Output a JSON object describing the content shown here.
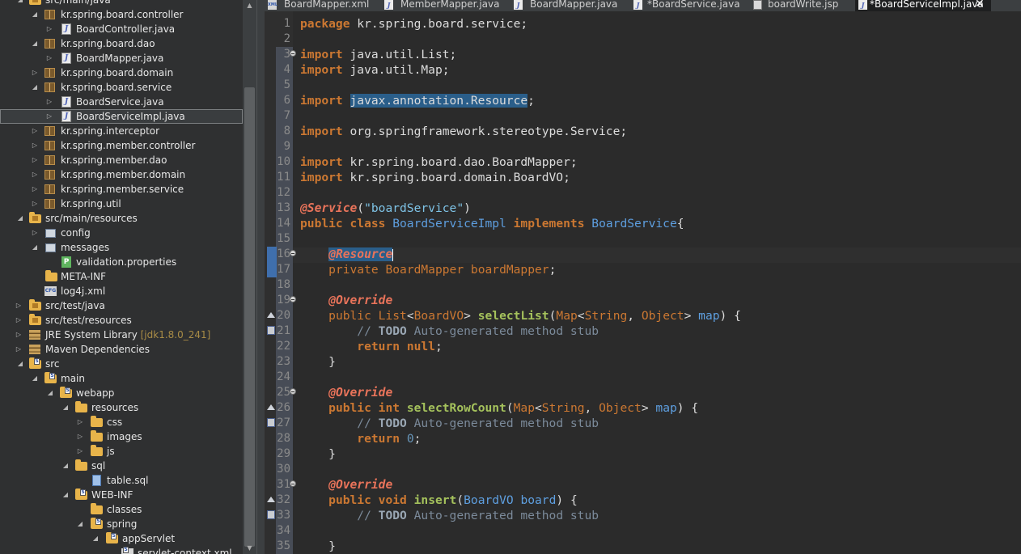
{
  "explorer": {
    "items": [
      {
        "label": "src/main/java",
        "icon": "source-folder-icon"
      },
      {
        "label": "kr.spring.board.controller",
        "icon": "package-icon"
      },
      {
        "label": "BoardController.java",
        "icon": "java-file-icon"
      },
      {
        "label": "kr.spring.board.dao",
        "icon": "package-icon"
      },
      {
        "label": "BoardMapper.java",
        "icon": "java-file-icon"
      },
      {
        "label": "kr.spring.board.domain",
        "icon": "package-icon"
      },
      {
        "label": "kr.spring.board.service",
        "icon": "package-icon"
      },
      {
        "label": "BoardService.java",
        "icon": "java-file-icon"
      },
      {
        "label": "BoardServiceImpl.java",
        "icon": "java-file-icon"
      },
      {
        "label": "kr.spring.interceptor",
        "icon": "package-icon"
      },
      {
        "label": "kr.spring.member.controller",
        "icon": "package-icon"
      },
      {
        "label": "kr.spring.member.dao",
        "icon": "package-icon"
      },
      {
        "label": "kr.spring.member.domain",
        "icon": "package-icon"
      },
      {
        "label": "kr.spring.member.service",
        "icon": "package-icon"
      },
      {
        "label": "kr.spring.util",
        "icon": "package-icon"
      },
      {
        "label": "src/main/resources",
        "icon": "source-folder-icon"
      },
      {
        "label": "config",
        "icon": "config-icon"
      },
      {
        "label": "messages",
        "icon": "config-icon"
      },
      {
        "label": "validation.properties",
        "icon": "properties-file-icon"
      },
      {
        "label": "META-INF",
        "icon": "folder-icon"
      },
      {
        "label": "log4j.xml",
        "icon": "xml-file-icon"
      },
      {
        "label": "src/test/java",
        "icon": "source-folder-icon"
      },
      {
        "label": "src/test/resources",
        "icon": "source-folder-icon"
      },
      {
        "label": "JRE System Library",
        "decoration": "[jdk1.8.0_241]",
        "icon": "library-icon"
      },
      {
        "label": "Maven Dependencies",
        "icon": "library-icon"
      },
      {
        "label": "src",
        "icon": "folder-icon"
      },
      {
        "label": "main",
        "icon": "folder-icon"
      },
      {
        "label": "webapp",
        "icon": "folder-icon"
      },
      {
        "label": "resources",
        "icon": "folder-icon"
      },
      {
        "label": "css",
        "icon": "folder-icon"
      },
      {
        "label": "images",
        "icon": "folder-icon"
      },
      {
        "label": "js",
        "icon": "folder-icon"
      },
      {
        "label": "sql",
        "icon": "folder-icon"
      },
      {
        "label": "table.sql",
        "icon": "sql-file-icon"
      },
      {
        "label": "WEB-INF",
        "icon": "folder-icon"
      },
      {
        "label": "classes",
        "icon": "folder-icon"
      },
      {
        "label": "spring",
        "icon": "folder-icon"
      },
      {
        "label": "appServlet",
        "icon": "folder-icon"
      },
      {
        "label": "servlet-context.xml",
        "icon": "xml-file-icon"
      }
    ]
  },
  "tabs": [
    {
      "label": "BoardMapper.xml",
      "icon": "xml-file-icon"
    },
    {
      "label": "MemberMapper.java",
      "icon": "java-file-icon"
    },
    {
      "label": "BoardMapper.java",
      "icon": "java-file-icon"
    },
    {
      "label": "*BoardService.java",
      "icon": "java-file-icon"
    },
    {
      "label": "boardWrite.jsp",
      "icon": "jsp-file-icon"
    },
    {
      "label": "*BoardServiceImpl.java",
      "icon": "java-file-icon",
      "active": true,
      "close": "✕"
    }
  ],
  "editor": {
    "line_numbers": [
      "1",
      "2",
      "3",
      "4",
      "5",
      "6",
      "7",
      "8",
      "9",
      "10",
      "11",
      "12",
      "13",
      "14",
      "15",
      "16",
      "17",
      "18",
      "19",
      "20",
      "21",
      "22",
      "23",
      "24",
      "25",
      "26",
      "27",
      "28",
      "29",
      "30",
      "31",
      "32",
      "33",
      "34",
      "35"
    ],
    "code": {
      "l1_kw": "package",
      "l1_rest": " kr.spring.board.service;",
      "l3_kw": "import",
      "l3_rest": " java.util.List;",
      "l4_kw": "import",
      "l4_rest": " java.util.Map;",
      "l6_kw": "import",
      "l6_hl": "javax.annotation.Resource",
      "l6_end": ";",
      "l8_kw": "import",
      "l8_rest": " org.springframework.stereotype.Service;",
      "l10_kw": "import",
      "l10_rest": " kr.spring.board.dao.BoardMapper;",
      "l11_kw": "import",
      "l11_rest": " kr.spring.board.domain.BoardVO;",
      "l13_an": "@Service",
      "l13_p1": "(",
      "l13_str": "\"boardService\"",
      "l13_p2": ")",
      "l14_kw1": "public class",
      "l14_cls": "BoardServiceImpl",
      "l14_kw2": "implements",
      "l14_iface": "BoardService",
      "l14_brace": "{",
      "l16_an": "@Resource",
      "l17_kw": "private",
      "l17_type": "BoardMapper",
      "l17_var": "boardMapper",
      "l17_end": ";",
      "l19_an": "@Override",
      "l20_kw": "public",
      "l20_type": "List",
      "l20_lt": "<",
      "l20_gen": "BoardVO",
      "l20_gt": ">",
      "l20_fn": "selectList",
      "l20_p1": "(",
      "l20_map": "Map",
      "l20_lt2": "<",
      "l20_str": "String",
      "l20_comma": ", ",
      "l20_obj": "Object",
      "l20_gt2": ">",
      "l20_arg": "map",
      "l20_end": ") {",
      "l21_c1": "// ",
      "l21_todo": "TODO",
      "l21_c2": " Auto-generated method stub",
      "l22_kw": "return",
      "l22_val": "null",
      "l22_end": ";",
      "l23": "}",
      "l25_an": "@Override",
      "l26_kw": "public",
      "l26_int": "int",
      "l26_fn": "selectRowCount",
      "l26_p1": "(",
      "l26_map": "Map",
      "l26_lt": "<",
      "l26_str": "String",
      "l26_comma": ", ",
      "l26_obj": "Object",
      "l26_gt": ">",
      "l26_arg": "map",
      "l26_end": ") {",
      "l27_c1": "// ",
      "l27_todo": "TODO",
      "l27_c2": " Auto-generated method stub",
      "l28_kw": "return",
      "l28_val": "0",
      "l28_end": ";",
      "l29": "}",
      "l31_an": "@Override",
      "l32_kw": "public",
      "l32_void": "void",
      "l32_fn": "insert",
      "l32_p1": "(",
      "l32_type": "BoardVO",
      "l32_arg": "board",
      "l32_end": ") {",
      "l33_c1": "// ",
      "l33_todo": "TODO",
      "l33_c2": " Auto-generated method stub",
      "l35": "}"
    }
  },
  "colors": {
    "editor_bg": "#2b2b2b",
    "explorer_bg": "#2f3031",
    "keyword": "#cc7832",
    "type": "#5e9fe0",
    "method": "#a5c25c",
    "annotation": "#e8735a",
    "comment": "#7b8a9a",
    "selection": "#2a5e8a"
  }
}
